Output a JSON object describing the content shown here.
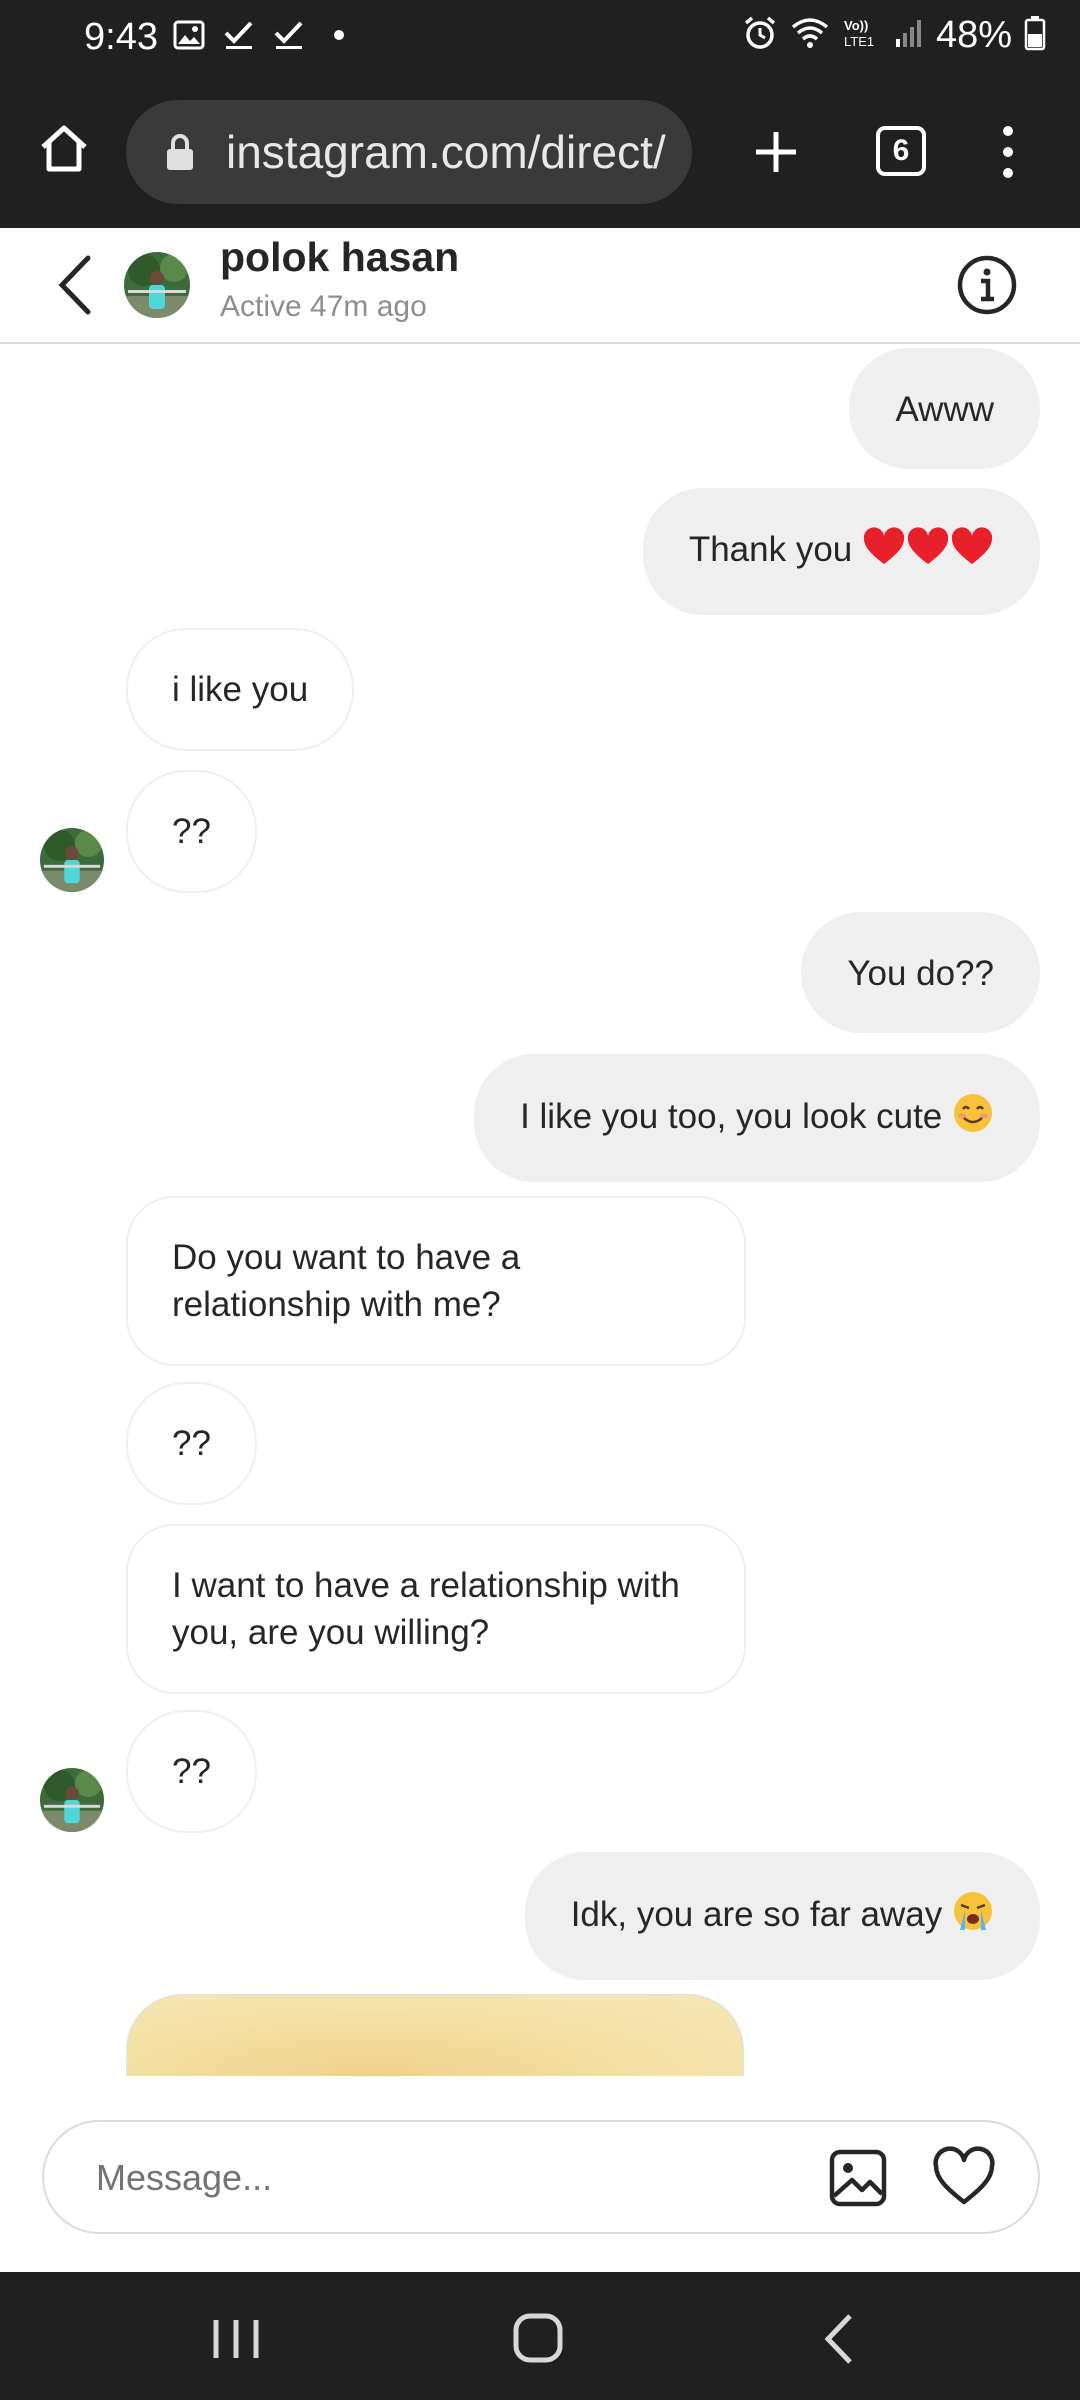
{
  "status_bar": {
    "time": "9:43",
    "battery_percent": "48%",
    "icons": [
      "gallery-icon",
      "check-icon",
      "check-icon",
      "dot-icon",
      "alarm-icon",
      "wifi-icon",
      "volte-icon",
      "signal-icon",
      "battery-icon"
    ]
  },
  "browser": {
    "url": "instagram.com/direct/",
    "tab_count": "6"
  },
  "chat_header": {
    "name": "polok hasan",
    "status": "Active 47m ago"
  },
  "messages": [
    {
      "direction": "out",
      "text": "Awww"
    },
    {
      "direction": "out",
      "text": "Thank you",
      "emoji": [
        "red-heart",
        "red-heart",
        "red-heart"
      ]
    },
    {
      "direction": "in",
      "text": "i like you"
    },
    {
      "direction": "in",
      "text": "??"
    },
    {
      "direction": "out",
      "text": "You do??"
    },
    {
      "direction": "out",
      "text": "I like you too, you look cute",
      "emoji": [
        "smiling-face"
      ]
    },
    {
      "direction": "in",
      "text": "Do you want to have a relationship with me?"
    },
    {
      "direction": "in",
      "text": "??"
    },
    {
      "direction": "in",
      "text": "I want to have a relationship with you, are you willing?"
    },
    {
      "direction": "in",
      "text": "??"
    },
    {
      "direction": "out",
      "text": "Idk, you are so far away",
      "emoji": [
        "loudly-crying-face"
      ]
    }
  ],
  "composer": {
    "placeholder": "Message..."
  },
  "colors": {
    "system_bar": "#202020",
    "outgoing_bubble": "#efefef",
    "incoming_border": "#efefef",
    "heart": "#e8202a"
  }
}
